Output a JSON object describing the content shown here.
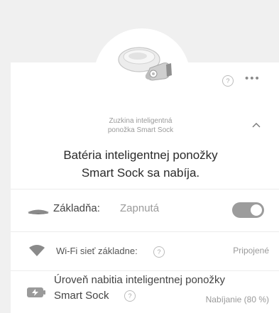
{
  "device": {
    "name_line1": "Zuzkina inteligentná",
    "name_line2": "ponožka Smart Sock",
    "help_glyph": "?",
    "more_glyph": "•••",
    "device_icon": "smart-sock-device-icon"
  },
  "status": {
    "line1": "Batéria inteligentnej ponožky",
    "line2": "Smart Sock sa nabíja."
  },
  "rows": {
    "base": {
      "label": "Základňa:",
      "value": "Zapnutá",
      "toggle_on": true,
      "icon": "base-station-icon"
    },
    "wifi": {
      "label": "Wi-Fi sieť základne:",
      "help_glyph": "?",
      "value": "Pripojené",
      "icon": "wifi-icon"
    },
    "battery": {
      "label_line1": "Úroveň nabitia inteligentnej ponožky",
      "label_line2": "Smart Sock",
      "help_glyph": "?",
      "value": "Nabíjanie (80 %)",
      "icon": "battery-charging-icon"
    }
  },
  "colors": {
    "background": "#f0f0f0",
    "card": "#ffffff",
    "toggle_on": "#9c9c9c"
  }
}
